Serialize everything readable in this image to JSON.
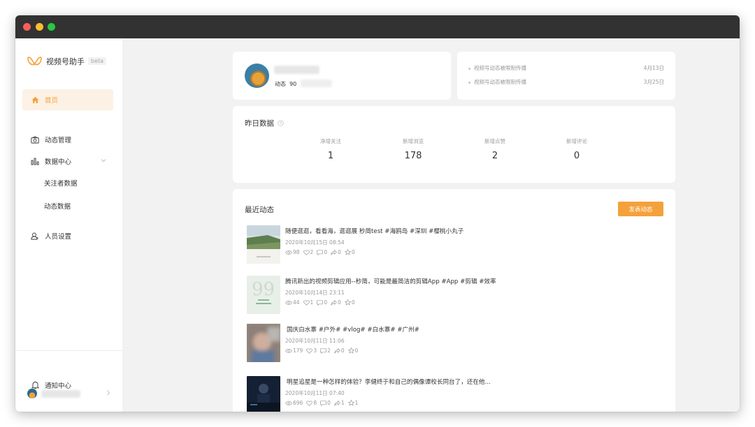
{
  "app": {
    "name": "视频号助手",
    "badge": "beta"
  },
  "sidebar": {
    "items": [
      {
        "label": "首页",
        "icon": "home-icon",
        "active": true
      },
      {
        "label": "动态管理",
        "icon": "camera-icon"
      },
      {
        "label": "数据中心",
        "icon": "bar-chart-icon"
      },
      {
        "label": "关注者数据"
      },
      {
        "label": "动态数据"
      },
      {
        "label": "人员设置",
        "icon": "person-icon"
      }
    ],
    "notify_label": "通知中心"
  },
  "profile": {
    "dynamic_label": "动态",
    "dynamic_count": "90"
  },
  "notices": [
    {
      "text": "视频号动态被限制传播",
      "date": "4月13日"
    },
    {
      "text": "视频号动态被限制传播",
      "date": "3月25日"
    }
  ],
  "yesterday": {
    "title": "昨日数据",
    "stats": [
      {
        "label": "净增关注",
        "value": "1"
      },
      {
        "label": "新增浏览",
        "value": "178"
      },
      {
        "label": "新增点赞",
        "value": "2"
      },
      {
        "label": "新增评论",
        "value": "0"
      }
    ]
  },
  "recent": {
    "title": "最近动态",
    "publish_label": "发表动态",
    "posts": [
      {
        "title": "随便逛逛，看看海，逛逛展 秒简test #海鸥岛 #深圳 #樱桃小丸子",
        "date": "2020年10月15日 08:54",
        "views": "98",
        "likes": "2",
        "comments": "0",
        "shares": "0",
        "favs": "0"
      },
      {
        "title": "腾讯新出的视频剪辑应用--秒简，可能是最简洁的剪辑App #App #剪辑 #效率",
        "date": "2020年10月14日 23:11",
        "views": "44",
        "likes": "1",
        "comments": "0",
        "shares": "0",
        "favs": "0"
      },
      {
        "title": "国庆白水寨 #户外#  #vlog#  #白水寨# #广州#",
        "date": "2020年10月11日 11:06",
        "views": "179",
        "likes": "3",
        "comments": "2",
        "shares": "0",
        "favs": "0"
      },
      {
        "title": "明星追星是一种怎样的体验？李健终于和自己的偶像谭校长同台了，还在他...",
        "date": "2020年10月11日 07:40",
        "views": "696",
        "likes": "8",
        "comments": "0",
        "shares": "1",
        "favs": "1"
      }
    ]
  },
  "colors": {
    "accent": "#f4a13b",
    "active_bg": "#fcf1e4",
    "titlebar": "#323232"
  }
}
